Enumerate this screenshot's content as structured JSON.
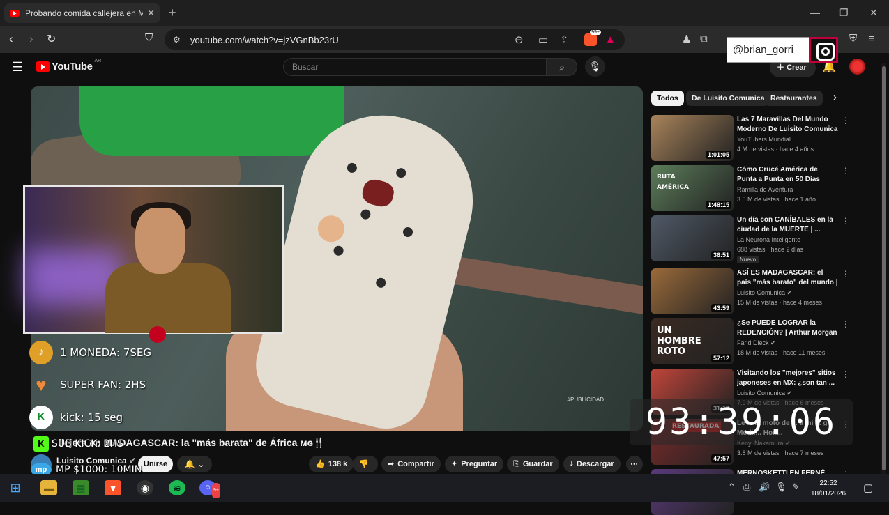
{
  "browser": {
    "tab_title": "Probando comida callejera en M",
    "url": "youtube.com/watch?v=jzVGnBb23rU",
    "shield_count": "99+"
  },
  "overlay": {
    "instagram_handle": "@brian_gorri"
  },
  "youtube": {
    "logo_text": "YouTube",
    "country_code": "AR",
    "search_placeholder": "Buscar",
    "create_label": "Crear"
  },
  "video": {
    "watermark": "#PUBLICIDAD",
    "title": "Probando comida callejera en MADAGASCAR: la \"más barata\" de África 🇲🇬🍴",
    "title_visible_prefix": "llejera en MADAGASCAR: la \"más barata\" de África ᴍɢ🍴",
    "channel": "Luisito Comunica",
    "join_label": "Unirse",
    "actions": [
      {
        "label": "138 k",
        "icon": "like-icon"
      },
      {
        "label": "",
        "icon": "dislike-icon"
      },
      {
        "label": "Compartir",
        "icon": "share-icon"
      },
      {
        "label": "Preguntar",
        "icon": "sparkle-icon"
      },
      {
        "label": "Guardar",
        "icon": "save-icon"
      },
      {
        "label": "Descargar",
        "icon": "download-icon"
      }
    ]
  },
  "stream_rewards": [
    {
      "text": "1 MONEDA: 7SEG",
      "icon": "tiktok-coin-icon",
      "color": "#e0a028"
    },
    {
      "text": "SUPER FAN: 2HS",
      "icon": "super-fan-icon",
      "color": "#f08a3a"
    },
    {
      "text": "kick: 15 seg",
      "icon": "kick-icon",
      "color": "#53fc18"
    },
    {
      "text": "SUB KICK: 2HS",
      "icon": "kick-icon",
      "color": "#53fc18"
    },
    {
      "text": "MP $1000: 10MIN",
      "icon": "mercadopago-icon",
      "color": "#3aa7e6"
    }
  ],
  "chips": [
    "Todos",
    "De Luisito Comunica",
    "Restaurantes"
  ],
  "recommended": [
    {
      "title": "Las 7 Maravillas Del Mundo Moderno De Luisito Comunica",
      "channel": "YouTubers Mundial",
      "meta": "4 M de vistas · hace 4 años",
      "duration": "1:01:05",
      "verified": false,
      "new": false,
      "color": "#a9845a"
    },
    {
      "title": "Cómo Crucé América de Punta a Punta en 50 Días",
      "channel": "Ramilla de Aventura",
      "meta": "3.5 M de vistas · hace 1 año",
      "duration": "1:48:15",
      "verified": false,
      "new": false,
      "color": "#5c7d5a"
    },
    {
      "title": "Un día con CANÍBALES en la ciudad de la MUERTE | ...",
      "channel": "La Neurona Inteligente",
      "meta": "688 vistas · hace 2 días",
      "duration": "36:51",
      "verified": false,
      "new": true,
      "new_label": "Nuevo",
      "color": "#4f5966"
    },
    {
      "title": "ASÍ ES MADAGASCAR: el país \"más barato\" del mundo | ...",
      "channel": "Luisito Comunica",
      "meta": "15 M de vistas · hace 4 meses",
      "duration": "43:59",
      "verified": true,
      "new": false,
      "color": "#9a6a3a"
    },
    {
      "title": "¿Se PUEDE LOGRAR la REDENCIÓN? | Arthur Morgan ...",
      "channel": "Farid Dieck",
      "meta": "18 M de vistas · hace 11 meses",
      "duration": "57:12",
      "verified": true,
      "new": false,
      "color": "#3a2a22"
    },
    {
      "title": "Visitando los \"mejores\" sitios japoneses en MX: ¿son tan ...",
      "channel": "Luisito Comunica",
      "meta": "7.9 M de vistas · hace 6 meses",
      "duration": "31:13",
      "verified": true,
      "new": false,
      "color": "#c0453a"
    },
    {
      "title": "Le ... la moto de ... a mi ... go Modif... Hon...",
      "channel": "Kenyi Nakamura",
      "meta": "3.8 M de vistas · hace 7 meses",
      "duration": "47:57",
      "verified": true,
      "new": false,
      "color": "#7a2a2a"
    },
    {
      "title": "MERNOSKETTI EN FERNÉ CON",
      "channel": "",
      "meta": "",
      "duration": "",
      "verified": false,
      "new": false,
      "color": "#5a3a7a"
    }
  ],
  "thumb_texts": {
    "hombre_roto": "UN HOMBRE ROTO",
    "restaurada": "RESTAURADA",
    "ruta_america": "RUTA AMÉRICA"
  },
  "timer": "93:39:06",
  "taskbar": {
    "time": "22:52",
    "date": "18/01/2026",
    "discord_badge": "9+"
  }
}
